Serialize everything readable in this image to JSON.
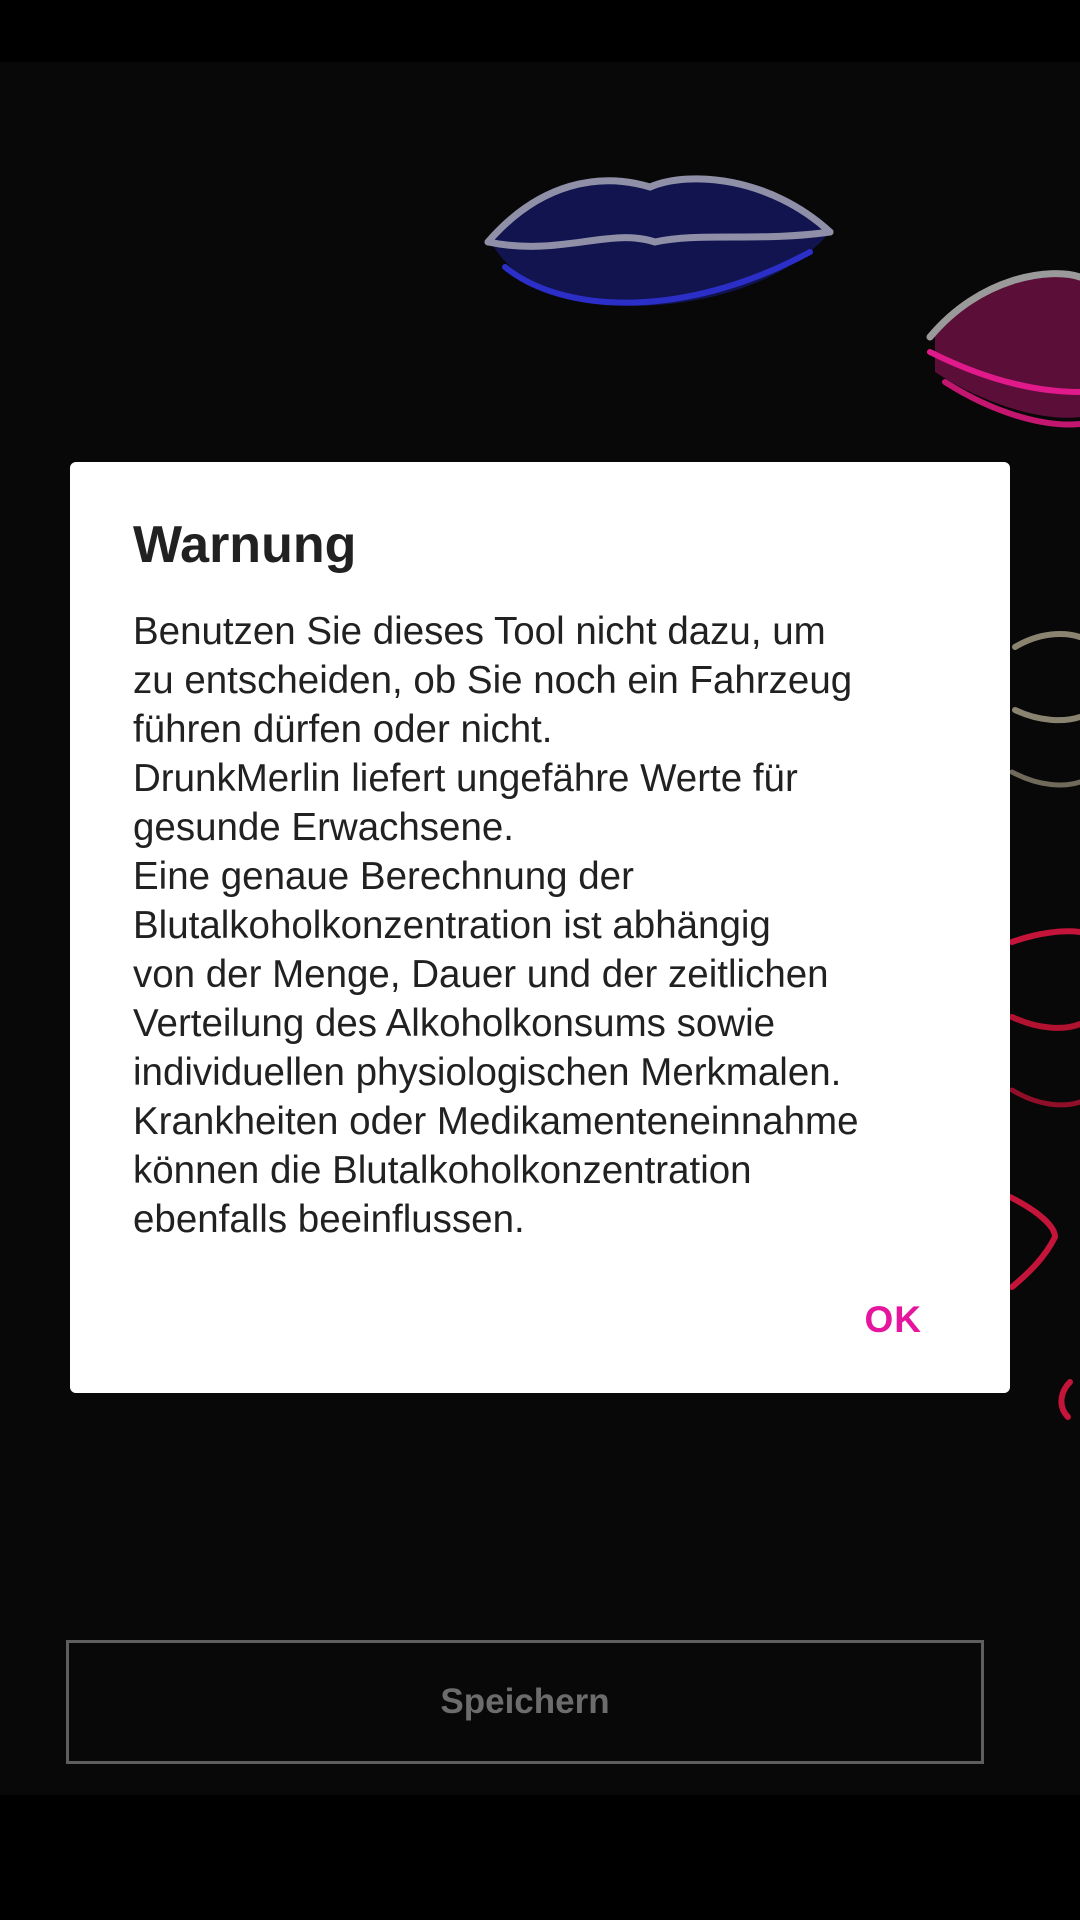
{
  "dialog": {
    "title": "Warnung",
    "message_lines": [
      "Benutzen Sie dieses Tool nicht dazu, um",
      "zu entscheiden, ob Sie noch ein Fahrzeug",
      "führen dürfen oder nicht.",
      "DrunkMerlin liefert ungefähre Werte für",
      "gesunde Erwachsene.",
      "Eine genaue Berechnung der",
      "Blutalkoholkonzentration ist abhängig",
      "von der Menge, Dauer und der zeitlichen",
      "Verteilung des Alkoholkonsums sowie",
      "individuellen physiologischen Merkmalen.",
      "Krankheiten oder Medikamenteneinnahme",
      "können die Blutalkoholkonzentration",
      "ebenfalls beeinflussen."
    ],
    "ok_label": "OK"
  },
  "main": {
    "save_label": "Speichern"
  },
  "colors": {
    "accent": "#e6159d",
    "background": "#080808",
    "dialog": "#ffffff"
  },
  "icons": [
    "neon-lips-blue",
    "neon-lips-pink",
    "neon-lips-gold",
    "neon-lips-red"
  ]
}
